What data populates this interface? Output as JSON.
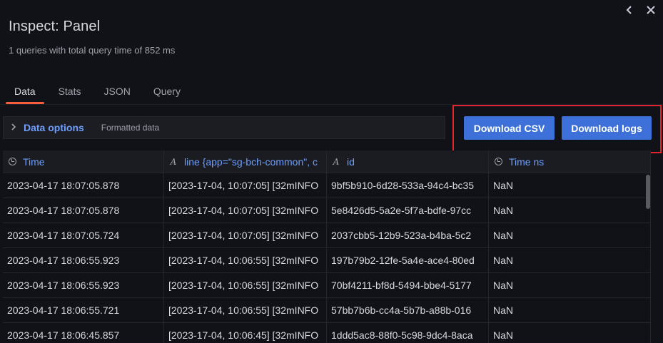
{
  "header": {
    "title": "Inspect: Panel",
    "subtitle": "1 queries with total query time of 852 ms",
    "back_icon": "chevron-left-icon",
    "close_icon": "close-icon"
  },
  "tabs": [
    {
      "label": "Data",
      "active": true
    },
    {
      "label": "Stats",
      "active": false
    },
    {
      "label": "JSON",
      "active": false
    },
    {
      "label": "Query",
      "active": false
    }
  ],
  "options": {
    "title": "Data options",
    "description": "Formatted data"
  },
  "buttons": {
    "download_csv": "Download CSV",
    "download_logs": "Download logs"
  },
  "table": {
    "columns": [
      {
        "label": "Time",
        "icon": "clock-icon"
      },
      {
        "label": "line {app=\"sg-bch-common\", c",
        "icon": "text-field-icon"
      },
      {
        "label": "id",
        "icon": "text-field-icon"
      },
      {
        "label": "Time ns",
        "icon": "clock-icon"
      }
    ],
    "rows": [
      [
        "2023-04-17 18:07:05.878",
        "[2023-17-04, 10:07:05]  [32mINFO",
        "9bf5b910-6d28-533a-94c4-bc35",
        "NaN"
      ],
      [
        "2023-04-17 18:07:05.878",
        "[2023-17-04, 10:07:05]  [32mINFO",
        "5e8426d5-5a2e-5f7a-bdfe-97cc",
        "NaN"
      ],
      [
        "2023-04-17 18:07:05.724",
        "[2023-17-04, 10:07:05]  [32mINFO",
        "2037cbb5-12b9-523a-b4ba-5c2",
        "NaN"
      ],
      [
        "2023-04-17 18:06:55.923",
        "[2023-17-04, 10:06:55]  [32mINFO",
        "197b79b2-12fe-5a4e-ace4-80ed",
        "NaN"
      ],
      [
        "2023-04-17 18:06:55.923",
        "[2023-17-04, 10:06:55]  [32mINFO",
        "70bf4211-bf8d-5494-bbe4-5177",
        "NaN"
      ],
      [
        "2023-04-17 18:06:55.721",
        "[2023-17-04, 10:06:55]  [32mINFO",
        "57bb7b6b-cc4a-5b7b-a88b-016",
        "NaN"
      ],
      [
        "2023-04-17 18:06:45.857",
        "[2023-17-04, 10:06:45]  [32mINFO",
        "1ddd5ac8-88f0-5c98-9dc4-8aca",
        "NaN"
      ]
    ]
  },
  "colors": {
    "accent": "#3d71d9",
    "tab_indicator": "#f55f3e",
    "link": "#6e9fff",
    "highlight": "#e0252e"
  }
}
